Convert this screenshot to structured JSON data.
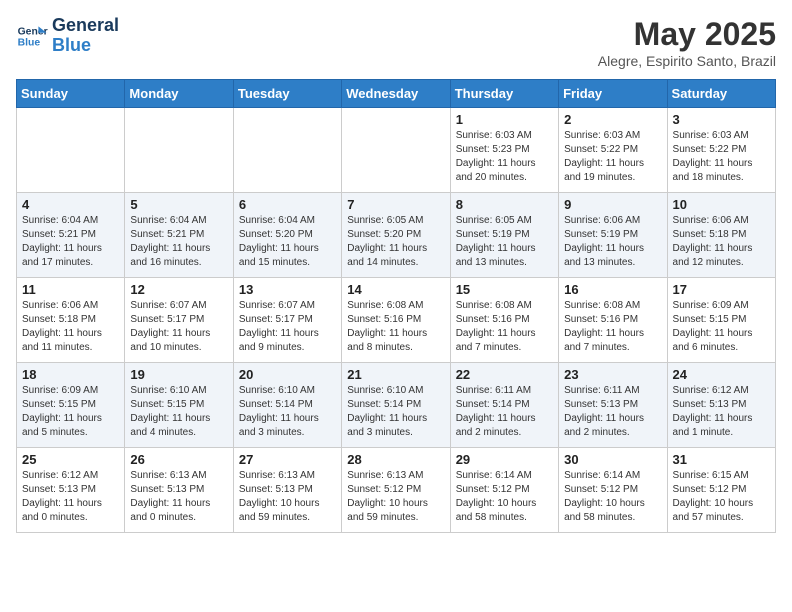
{
  "header": {
    "logo_line1": "General",
    "logo_line2": "Blue",
    "month_year": "May 2025",
    "location": "Alegre, Espirito Santo, Brazil"
  },
  "days_of_week": [
    "Sunday",
    "Monday",
    "Tuesday",
    "Wednesday",
    "Thursday",
    "Friday",
    "Saturday"
  ],
  "weeks": [
    [
      {
        "day": "",
        "info": ""
      },
      {
        "day": "",
        "info": ""
      },
      {
        "day": "",
        "info": ""
      },
      {
        "day": "",
        "info": ""
      },
      {
        "day": "1",
        "info": "Sunrise: 6:03 AM\nSunset: 5:23 PM\nDaylight: 11 hours\nand 20 minutes."
      },
      {
        "day": "2",
        "info": "Sunrise: 6:03 AM\nSunset: 5:22 PM\nDaylight: 11 hours\nand 19 minutes."
      },
      {
        "day": "3",
        "info": "Sunrise: 6:03 AM\nSunset: 5:22 PM\nDaylight: 11 hours\nand 18 minutes."
      }
    ],
    [
      {
        "day": "4",
        "info": "Sunrise: 6:04 AM\nSunset: 5:21 PM\nDaylight: 11 hours\nand 17 minutes."
      },
      {
        "day": "5",
        "info": "Sunrise: 6:04 AM\nSunset: 5:21 PM\nDaylight: 11 hours\nand 16 minutes."
      },
      {
        "day": "6",
        "info": "Sunrise: 6:04 AM\nSunset: 5:20 PM\nDaylight: 11 hours\nand 15 minutes."
      },
      {
        "day": "7",
        "info": "Sunrise: 6:05 AM\nSunset: 5:20 PM\nDaylight: 11 hours\nand 14 minutes."
      },
      {
        "day": "8",
        "info": "Sunrise: 6:05 AM\nSunset: 5:19 PM\nDaylight: 11 hours\nand 13 minutes."
      },
      {
        "day": "9",
        "info": "Sunrise: 6:06 AM\nSunset: 5:19 PM\nDaylight: 11 hours\nand 13 minutes."
      },
      {
        "day": "10",
        "info": "Sunrise: 6:06 AM\nSunset: 5:18 PM\nDaylight: 11 hours\nand 12 minutes."
      }
    ],
    [
      {
        "day": "11",
        "info": "Sunrise: 6:06 AM\nSunset: 5:18 PM\nDaylight: 11 hours\nand 11 minutes."
      },
      {
        "day": "12",
        "info": "Sunrise: 6:07 AM\nSunset: 5:17 PM\nDaylight: 11 hours\nand 10 minutes."
      },
      {
        "day": "13",
        "info": "Sunrise: 6:07 AM\nSunset: 5:17 PM\nDaylight: 11 hours\nand 9 minutes."
      },
      {
        "day": "14",
        "info": "Sunrise: 6:08 AM\nSunset: 5:16 PM\nDaylight: 11 hours\nand 8 minutes."
      },
      {
        "day": "15",
        "info": "Sunrise: 6:08 AM\nSunset: 5:16 PM\nDaylight: 11 hours\nand 7 minutes."
      },
      {
        "day": "16",
        "info": "Sunrise: 6:08 AM\nSunset: 5:16 PM\nDaylight: 11 hours\nand 7 minutes."
      },
      {
        "day": "17",
        "info": "Sunrise: 6:09 AM\nSunset: 5:15 PM\nDaylight: 11 hours\nand 6 minutes."
      }
    ],
    [
      {
        "day": "18",
        "info": "Sunrise: 6:09 AM\nSunset: 5:15 PM\nDaylight: 11 hours\nand 5 minutes."
      },
      {
        "day": "19",
        "info": "Sunrise: 6:10 AM\nSunset: 5:15 PM\nDaylight: 11 hours\nand 4 minutes."
      },
      {
        "day": "20",
        "info": "Sunrise: 6:10 AM\nSunset: 5:14 PM\nDaylight: 11 hours\nand 3 minutes."
      },
      {
        "day": "21",
        "info": "Sunrise: 6:10 AM\nSunset: 5:14 PM\nDaylight: 11 hours\nand 3 minutes."
      },
      {
        "day": "22",
        "info": "Sunrise: 6:11 AM\nSunset: 5:14 PM\nDaylight: 11 hours\nand 2 minutes."
      },
      {
        "day": "23",
        "info": "Sunrise: 6:11 AM\nSunset: 5:13 PM\nDaylight: 11 hours\nand 2 minutes."
      },
      {
        "day": "24",
        "info": "Sunrise: 6:12 AM\nSunset: 5:13 PM\nDaylight: 11 hours\nand 1 minute."
      }
    ],
    [
      {
        "day": "25",
        "info": "Sunrise: 6:12 AM\nSunset: 5:13 PM\nDaylight: 11 hours\nand 0 minutes."
      },
      {
        "day": "26",
        "info": "Sunrise: 6:13 AM\nSunset: 5:13 PM\nDaylight: 11 hours\nand 0 minutes."
      },
      {
        "day": "27",
        "info": "Sunrise: 6:13 AM\nSunset: 5:13 PM\nDaylight: 10 hours\nand 59 minutes."
      },
      {
        "day": "28",
        "info": "Sunrise: 6:13 AM\nSunset: 5:12 PM\nDaylight: 10 hours\nand 59 minutes."
      },
      {
        "day": "29",
        "info": "Sunrise: 6:14 AM\nSunset: 5:12 PM\nDaylight: 10 hours\nand 58 minutes."
      },
      {
        "day": "30",
        "info": "Sunrise: 6:14 AM\nSunset: 5:12 PM\nDaylight: 10 hours\nand 58 minutes."
      },
      {
        "day": "31",
        "info": "Sunrise: 6:15 AM\nSunset: 5:12 PM\nDaylight: 10 hours\nand 57 minutes."
      }
    ]
  ]
}
